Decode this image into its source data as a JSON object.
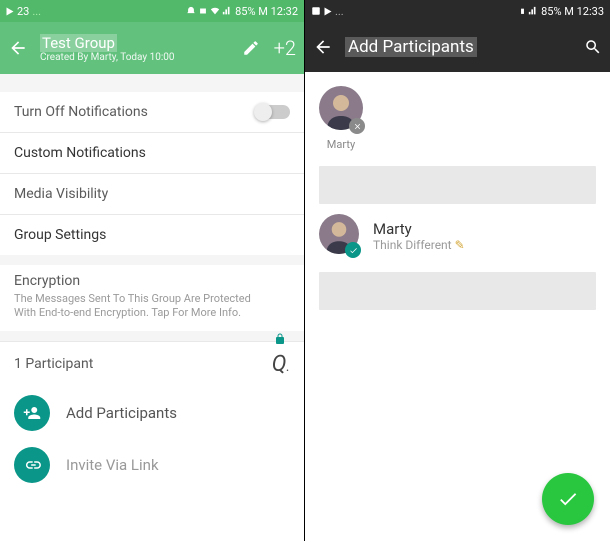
{
  "left": {
    "status": {
      "notif_count": "23",
      "battery_text": "85% M 12:32"
    },
    "header": {
      "title": "Test  Group",
      "subtitle": "Created By Marty, Today 10:00",
      "plus_count": "+2"
    },
    "rows": {
      "turn_off": "Turn Off Notifications",
      "custom": "Custom Notifications",
      "media": "Media Visibility",
      "group_settings": "Group Settings",
      "encryption_title": "Encryption",
      "encryption_desc": "The Messages Sent To This Group Are Protected With End-to-end Encryption. Tap For More Info.",
      "participant_count": "1 Participant",
      "search_q": "Q",
      "add_participants": "Add Participants",
      "invite_link": "Invite Via Link"
    }
  },
  "right": {
    "status": {
      "battery_text": "85% M 12:33"
    },
    "header": {
      "title": "Add Participants"
    },
    "selected": {
      "name": "Marty"
    },
    "contact": {
      "name": "Marty",
      "status": "Think Different"
    }
  }
}
